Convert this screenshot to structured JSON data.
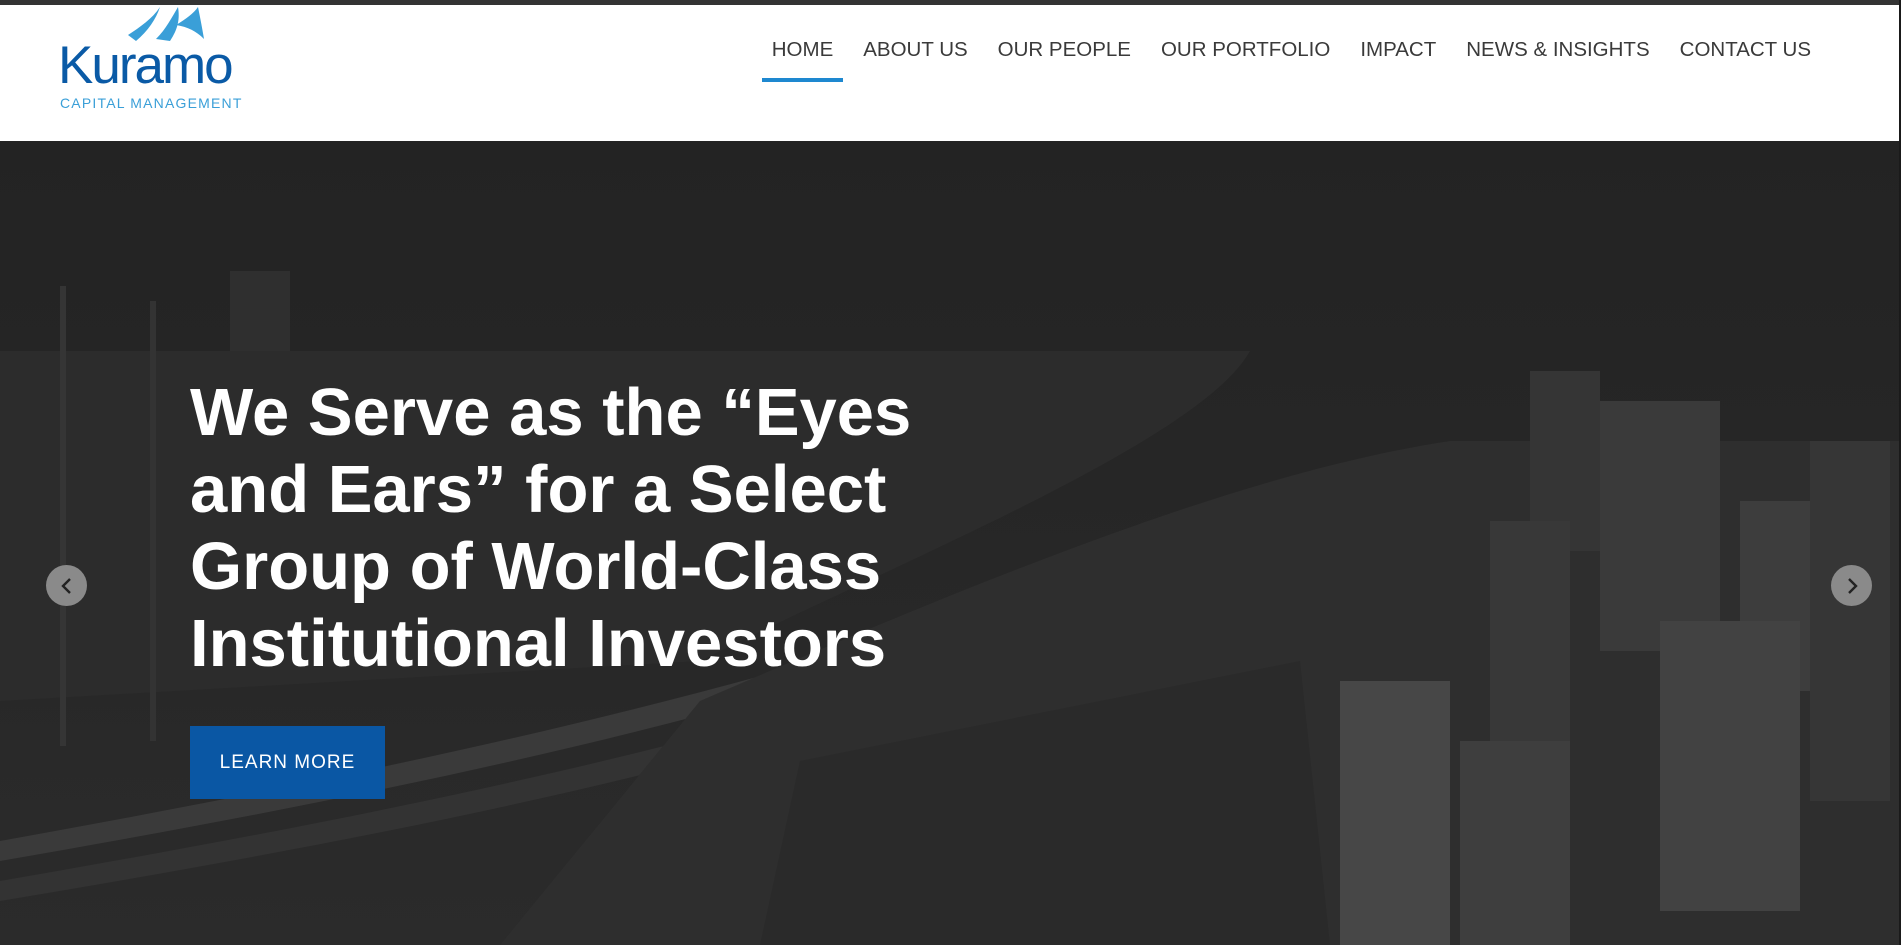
{
  "brand": {
    "name": "Kuramo",
    "tagline": "CAPITAL MANAGEMENT",
    "colors": {
      "primary": "#0a5aa6",
      "accent": "#3a9fd8",
      "nav_underline": "#1e88d0"
    }
  },
  "nav": {
    "items": [
      {
        "label": "HOME",
        "active": true
      },
      {
        "label": "ABOUT US",
        "active": false
      },
      {
        "label": "OUR PEOPLE",
        "active": false
      },
      {
        "label": "OUR PORTFOLIO",
        "active": false
      },
      {
        "label": "IMPACT",
        "active": false
      },
      {
        "label": "NEWS & INSIGHTS",
        "active": false
      },
      {
        "label": "CONTACT US",
        "active": false
      }
    ]
  },
  "hero": {
    "headline": "We Serve as the “Eyes and Ears” for a Select Group of World-Class Institutional Investors",
    "cta_label": "LEARN MORE",
    "prev_icon": "chevron-left-icon",
    "next_icon": "chevron-right-icon"
  }
}
